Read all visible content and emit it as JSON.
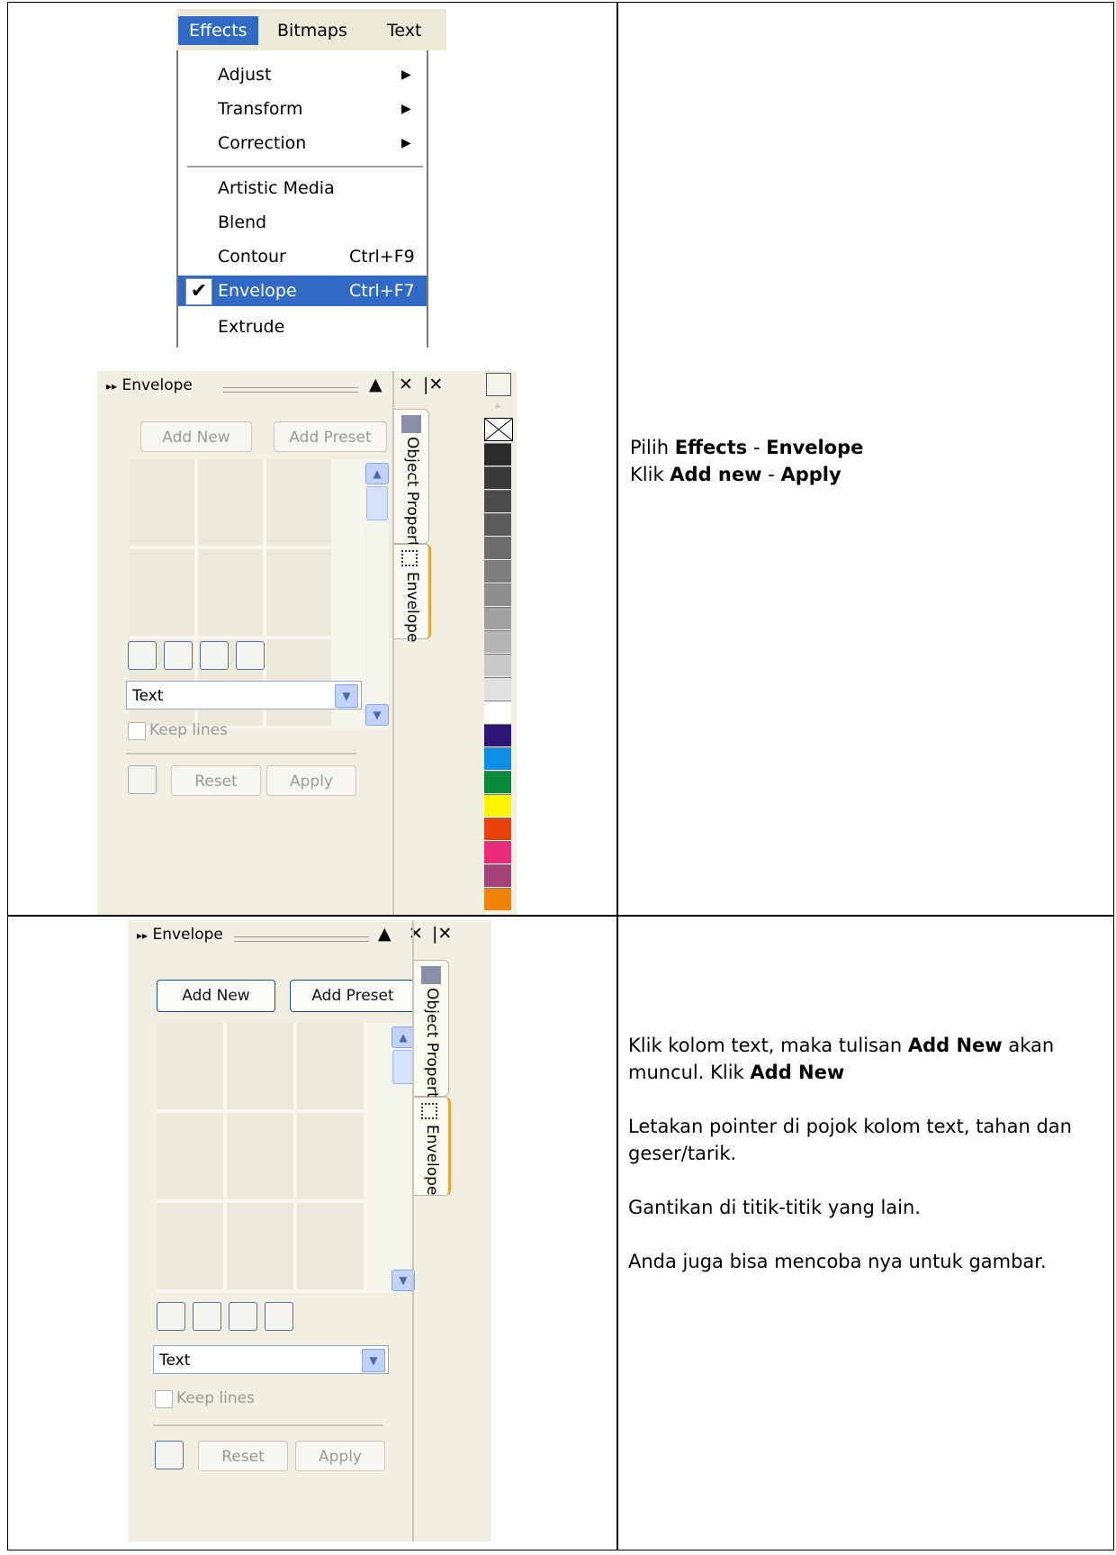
{
  "menu": {
    "bar": [
      "Effects",
      "Bitmaps",
      "Text"
    ],
    "items": [
      {
        "label": "Adjust",
        "submenu": true
      },
      {
        "label": "Transform",
        "submenu": true
      },
      {
        "label": "Correction",
        "submenu": true
      },
      {
        "label": "Artistic Media"
      },
      {
        "label": "Blend"
      },
      {
        "label": "Contour",
        "shortcut": "Ctrl+F9"
      },
      {
        "label": "Envelope",
        "shortcut": "Ctrl+F7",
        "selected": true
      },
      {
        "label": "Extrude"
      }
    ]
  },
  "docker1": {
    "title": "Envelope",
    "add_new": "Add New",
    "add_preset": "Add Preset",
    "mode": "Text",
    "keep_lines": "Keep lines",
    "reset": "Reset",
    "apply": "Apply",
    "tab_object": "Object Properties",
    "tab_envelope": "Envelope"
  },
  "docker2": {
    "title": "Envelope",
    "add_new": "Add New",
    "add_preset": "Add Preset",
    "mode": "Text",
    "keep_lines": "Keep lines",
    "reset": "Reset",
    "apply": "Apply",
    "tab_object": "Object Properties",
    "tab_envelope": "Envelope"
  },
  "palette_colors": [
    "#2b2b2b",
    "#3a3a3a",
    "#4b4b4b",
    "#5c5c5c",
    "#6d6d6d",
    "#7e7e7e",
    "#8f8f8f",
    "#a0a0a0",
    "#b5b5b5",
    "#cacaca",
    "#e0e0e0",
    "#ffffff",
    "#2e1676",
    "#0a8ee6",
    "#0a8a3c",
    "#fff500",
    "#e6420a",
    "#ea2a7a",
    "#a44278",
    "#f2820a"
  ],
  "row1": {
    "line1": {
      "a": "Pilih ",
      "b": "Effects",
      "c": " - ",
      "d": "Envelope"
    },
    "line2": {
      "a": "Klik ",
      "b": "Add new",
      "c": " - ",
      "d": "Apply"
    }
  },
  "row2": {
    "p1": {
      "a": "Klik kolom text, maka tulisan ",
      "b": "Add New",
      "c": " akan muncul. Klik ",
      "d": "Add New"
    },
    "p2": "Letakan pointer di pojok kolom text, tahan dan geser/tarik.",
    "p3": "Gantikan di titik-titik yang lain.",
    "p4": "Anda juga bisa mencoba nya untuk gambar."
  }
}
